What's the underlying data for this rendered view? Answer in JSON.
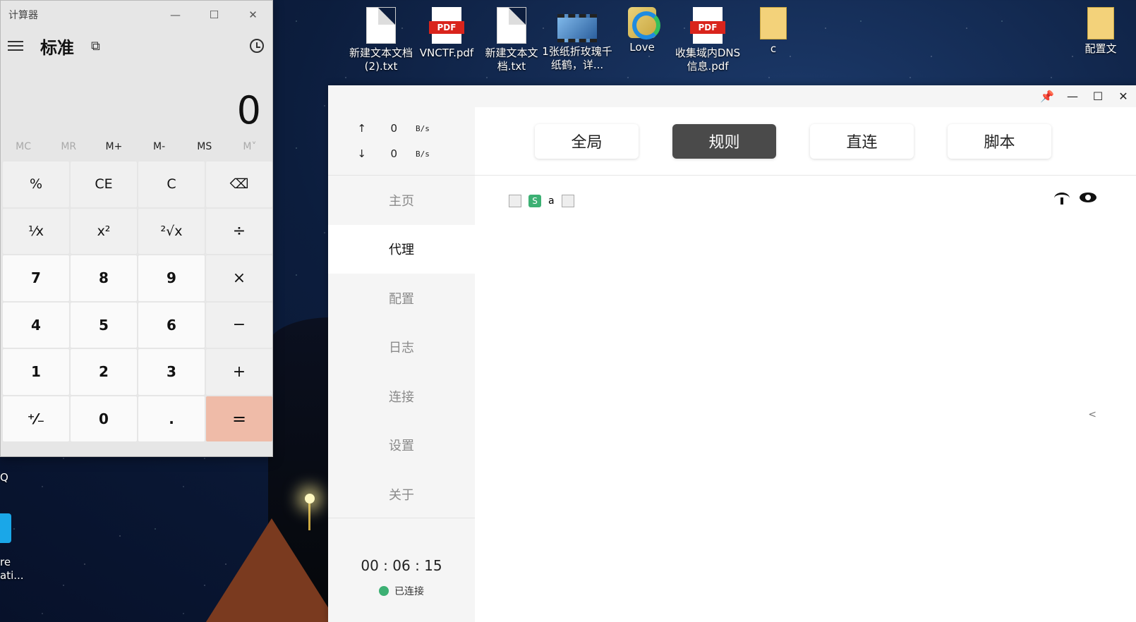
{
  "calculator": {
    "title": "计算器",
    "mode": "标准",
    "display": "0",
    "memory": [
      "MC",
      "MR",
      "M+",
      "M-",
      "MS",
      "M˅"
    ],
    "keys": [
      "%",
      "CE",
      "C",
      "⌫",
      "¹⁄x",
      "x²",
      "²√x",
      "÷",
      "7",
      "8",
      "9",
      "×",
      "4",
      "5",
      "6",
      "−",
      "1",
      "2",
      "3",
      "+",
      "⁺⁄₋",
      "0",
      ".",
      "="
    ]
  },
  "desktop": {
    "icons": [
      {
        "label": "新建文本文档 (2).txt",
        "type": "txt"
      },
      {
        "label": "VNCTF.pdf",
        "type": "pdf"
      },
      {
        "label": "新建文本文档.txt",
        "type": "txt"
      },
      {
        "label": "1张纸折玫瑰千纸鹤，详...",
        "type": "video"
      },
      {
        "label": "Love",
        "type": "edge"
      },
      {
        "label": "收集域内DNS信息.pdf",
        "type": "pdf"
      },
      {
        "label": "c",
        "type": "folder"
      },
      {
        "label": "配置文",
        "type": "folder"
      }
    ],
    "left_labels": [
      "Q",
      "re",
      "ati..."
    ],
    "pdf_badge": "PDF"
  },
  "clash": {
    "upload": {
      "arrow": "↑",
      "value": "0",
      "unit": "B/s"
    },
    "download": {
      "arrow": "↓",
      "value": "0",
      "unit": "B/s"
    },
    "nav": [
      "主页",
      "代理",
      "配置",
      "日志",
      "连接",
      "设置",
      "关于"
    ],
    "active_nav": "代理",
    "modes": [
      "全局",
      "规则",
      "直连",
      "脚本"
    ],
    "active_mode": "规则",
    "proxy_text": "a",
    "proxy_badge": "S",
    "timer": "00 : 06 : 15",
    "status": "已连接",
    "collapse": "<"
  }
}
